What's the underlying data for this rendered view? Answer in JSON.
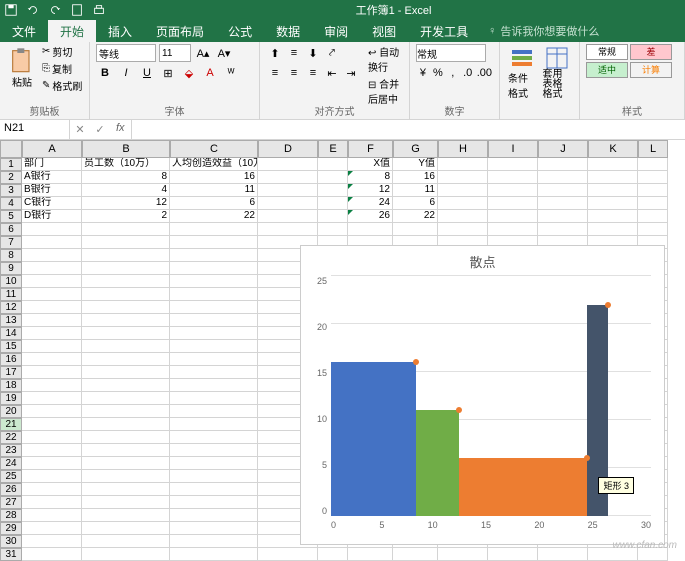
{
  "window": {
    "title": "工作簿1 - Excel"
  },
  "tabs": [
    "文件",
    "开始",
    "插入",
    "页面布局",
    "公式",
    "数据",
    "审阅",
    "视图",
    "开发工具"
  ],
  "tell_me": "告诉我你想要做什么",
  "ribbon": {
    "clipboard": {
      "paste": "粘贴",
      "cut": "剪切",
      "copy": "复制",
      "painter": "格式刷",
      "label": "剪贴板"
    },
    "font": {
      "name": "等线",
      "size": "11",
      "label": "字体"
    },
    "align": {
      "wrap": "自动换行",
      "merge": "合并后居中",
      "label": "对齐方式"
    },
    "number": {
      "format": "常规",
      "label": "数字"
    },
    "styles": {
      "cond": "条件格式",
      "table": "套用\n表格格式",
      "label": "样式",
      "cells": {
        "normal": "常规",
        "bad": "差",
        "good": "适中",
        "calc": "计算"
      }
    }
  },
  "namebox": "N21",
  "sheet": {
    "cols": [
      "A",
      "B",
      "C",
      "D",
      "E",
      "F",
      "G",
      "H",
      "I",
      "J",
      "K",
      "L"
    ],
    "headers": {
      "A1": "部门",
      "B1": "员工数（10万）",
      "C1": "人均创造效益（10万）",
      "F1": "X值",
      "G1": "Y值"
    },
    "data": [
      {
        "A": "A银行",
        "B": 8,
        "C": 16,
        "F": 8,
        "G": 16
      },
      {
        "A": "B银行",
        "B": 4,
        "C": 11,
        "F": 12,
        "G": 11
      },
      {
        "A": "C银行",
        "B": 12,
        "C": 6,
        "F": 24,
        "G": 6
      },
      {
        "A": "D银行",
        "B": 2,
        "C": 22,
        "F": 26,
        "G": 22
      }
    ]
  },
  "chart_data": {
    "type": "bar",
    "title": "散点",
    "xlim": [
      0,
      30
    ],
    "ylim": [
      0,
      25
    ],
    "xticks": [
      0,
      5,
      10,
      15,
      20,
      25,
      30
    ],
    "yticks": [
      0,
      5,
      10,
      15,
      20,
      25
    ],
    "bars": [
      {
        "x0": 0,
        "x1": 8,
        "y": 16,
        "color": "#4472c4"
      },
      {
        "x0": 8,
        "x1": 12,
        "y": 11,
        "color": "#70ad47"
      },
      {
        "x0": 12,
        "x1": 24,
        "y": 6,
        "color": "#ed7d31"
      },
      {
        "x0": 24,
        "x1": 26,
        "y": 22,
        "color": "#44546a"
      }
    ],
    "scatter": [
      {
        "x": 8,
        "y": 16
      },
      {
        "x": 12,
        "y": 11
      },
      {
        "x": 24,
        "y": 6
      },
      {
        "x": 26,
        "y": 22
      }
    ],
    "tooltip": "矩形 3"
  },
  "watermark": "www.cfan.com"
}
